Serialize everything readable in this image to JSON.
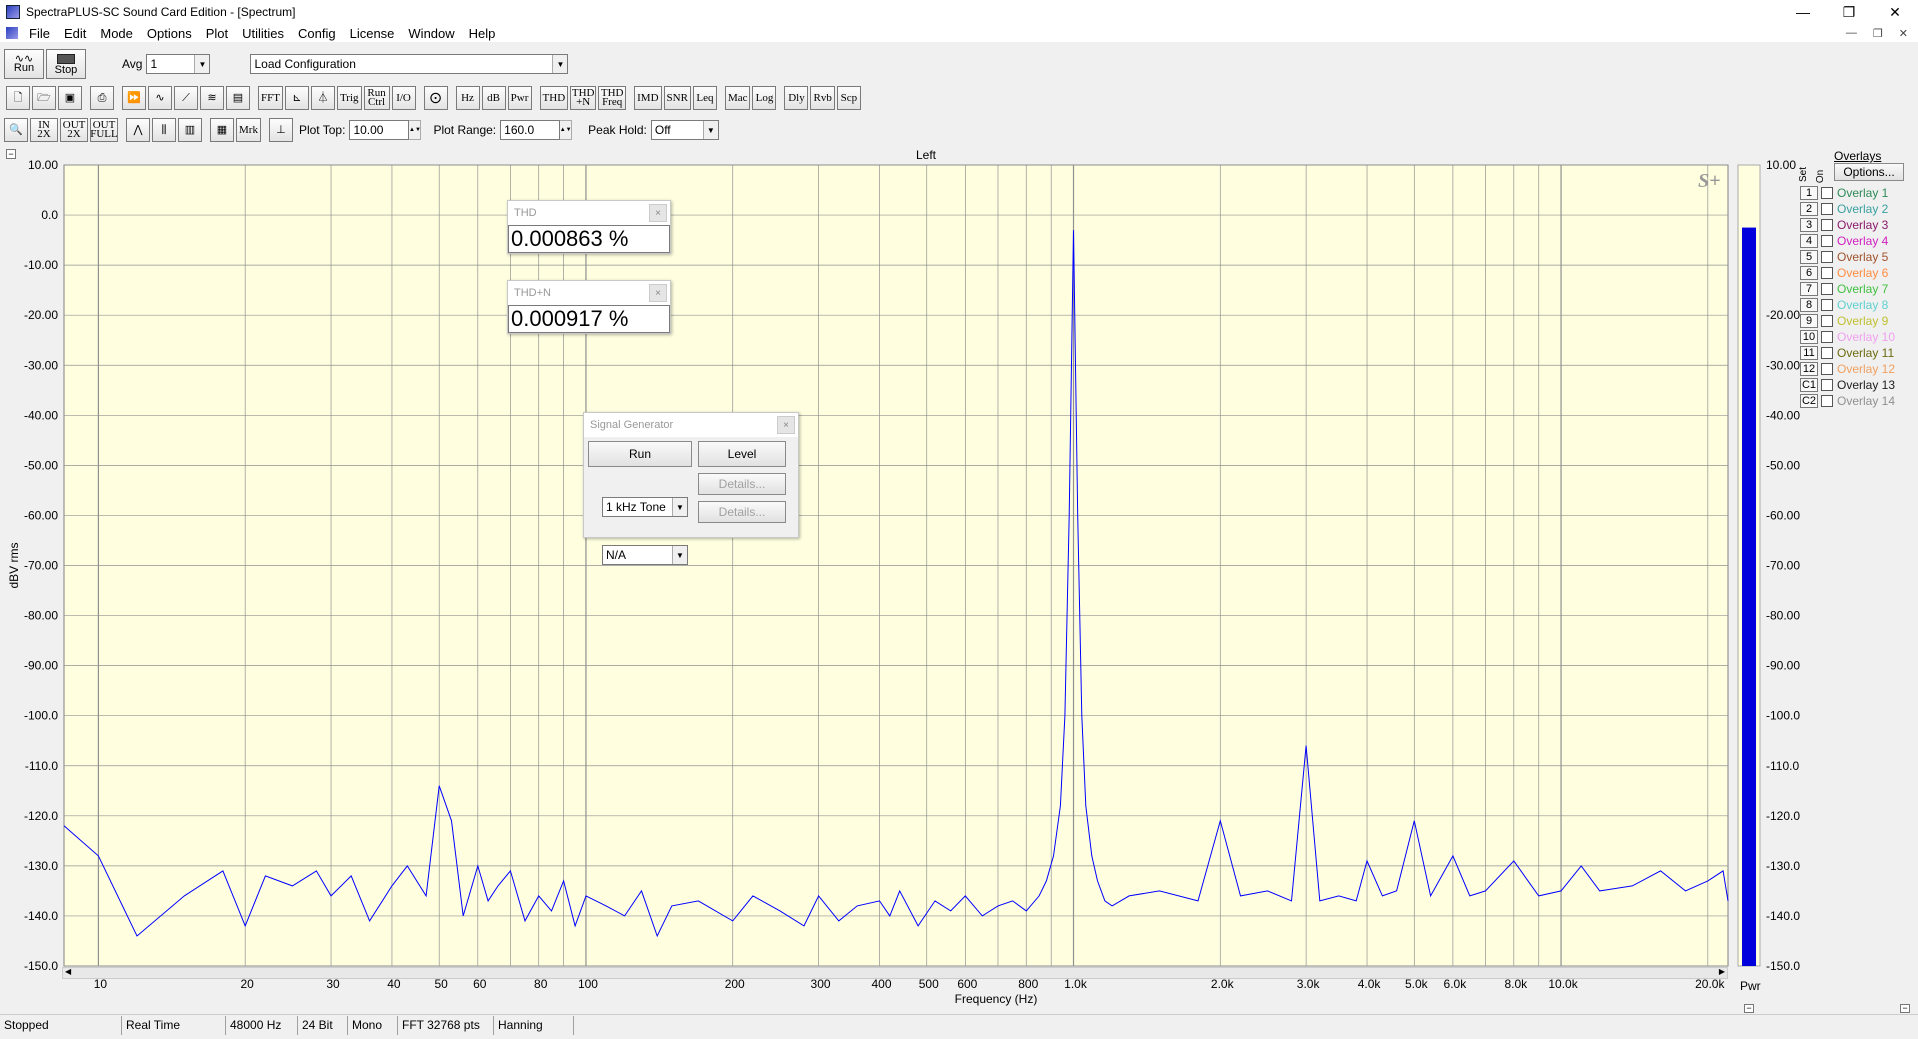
{
  "window": {
    "title": "SpectraPLUS-SC Sound Card Edition - [Spectrum]",
    "controls": [
      "—",
      "❐",
      "✕"
    ],
    "mdi_controls": [
      "—",
      "❐",
      "✕"
    ]
  },
  "menu": [
    "File",
    "Edit",
    "Mode",
    "Options",
    "Plot",
    "Utilities",
    "Config",
    "License",
    "Window",
    "Help"
  ],
  "toolbar1": {
    "run_label": "Run",
    "stop_label": "Stop",
    "avg_label": "Avg",
    "avg_value": "1",
    "config_value": "Load Configuration"
  },
  "toolbar2": [
    "FFT",
    "Trig",
    "Run Ctrl",
    "I/O",
    "Hz",
    "dB",
    "Pwr",
    "THD",
    "THD +N",
    "THD Freq",
    "IMD",
    "SNR",
    "Leq",
    "Mac",
    "Log",
    "Dly",
    "Rvb",
    "Scp"
  ],
  "toolbar3": {
    "icon_labels": [
      "IN 2X",
      "OUT 2X",
      "OUT FULL",
      "Mrk"
    ],
    "plot_top_label": "Plot Top:",
    "plot_top_value": "10.00",
    "plot_range_label": "Plot Range:",
    "plot_range_value": "160.0",
    "peak_hold_label": "Peak Hold:",
    "peak_hold_value": "Off"
  },
  "plot": {
    "channel_label": "Left",
    "watermark": "S+",
    "ylabel": "dBV rms",
    "xlabel": "Frequency (Hz)",
    "pwr_label": "Pwr",
    "y_ticks": [
      "10.00",
      "0.0",
      "-10.00",
      "-20.00",
      "-30.00",
      "-40.00",
      "-50.00",
      "-60.00",
      "-70.00",
      "-80.00",
      "-90.00",
      "-100.0",
      "-110.0",
      "-120.0",
      "-130.0",
      "-140.0",
      "-150.0"
    ],
    "x_ticks": [
      "10",
      "20",
      "30",
      "40",
      "50",
      "60",
      "80",
      "100",
      "200",
      "300",
      "400",
      "500",
      "600",
      "800",
      "1.0k",
      "2.0k",
      "3.0k",
      "4.0k",
      "5.0k",
      "6.0k",
      "8.0k",
      "10.0k",
      "20.0k"
    ],
    "meter_ticks": [
      "10.00",
      "-20.00",
      "-30.00",
      "-40.00",
      "-50.00",
      "-60.00",
      "-70.00",
      "-80.00",
      "-90.00",
      "-100.0",
      "-110.0",
      "-120.0",
      "-130.0",
      "-140.0",
      "-150.0"
    ],
    "meter_level_db": -2.5,
    "plot_bg": "#ffffe0",
    "trace_color": "#0000ff"
  },
  "chart_data": {
    "type": "line",
    "title": "Left",
    "xlabel": "Frequency (Hz)",
    "ylabel": "dBV rms",
    "xscale": "log",
    "xlim": [
      8.5,
      22000
    ],
    "ylim": [
      -150,
      10
    ],
    "grid": true,
    "series": [
      {
        "x": [
          8.5,
          10,
          12,
          15,
          18,
          20,
          22,
          25,
          28,
          30,
          33,
          36,
          40,
          43,
          47,
          50,
          53,
          56,
          60,
          63,
          66,
          70,
          75,
          80,
          85,
          90,
          95,
          100,
          110,
          120,
          130,
          140,
          150,
          170,
          200,
          220,
          250,
          280,
          300,
          330,
          360,
          400,
          420,
          440,
          480,
          520,
          560,
          600,
          650,
          700,
          750,
          800,
          850,
          880,
          910,
          940,
          960,
          980,
          1000,
          1020,
          1040,
          1060,
          1090,
          1120,
          1160,
          1200,
          1300,
          1500,
          1800,
          2000,
          2200,
          2500,
          2800,
          3000,
          3200,
          3500,
          3800,
          4000,
          4300,
          4600,
          5000,
          5400,
          6000,
          6500,
          7000,
          8000,
          9000,
          10000,
          11000,
          12000,
          14000,
          16000,
          18000,
          20000,
          21500,
          22000
        ],
        "y": [
          -122,
          -128,
          -144,
          -136,
          -131,
          -142,
          -132,
          -134,
          -131,
          -136,
          -132,
          -141,
          -134,
          -130,
          -136,
          -114,
          -121,
          -140,
          -130,
          -137,
          -134,
          -131,
          -141,
          -136,
          -139,
          -133,
          -142,
          -136,
          -138,
          -140,
          -135,
          -144,
          -138,
          -137,
          -141,
          -136,
          -139,
          -142,
          -136,
          -141,
          -138,
          -137,
          -140,
          -135,
          -142,
          -137,
          -139,
          -136,
          -140,
          -138,
          -137,
          -139,
          -136,
          -133,
          -128,
          -118,
          -100,
          -60,
          -3,
          -60,
          -100,
          -118,
          -128,
          -133,
          -137,
          -138,
          -136,
          -135,
          -137,
          -121,
          -136,
          -135,
          -137,
          -106,
          -137,
          -136,
          -137,
          -129,
          -136,
          -135,
          -121,
          -136,
          -128,
          -136,
          -135,
          -129,
          -136,
          -135,
          -130,
          -135,
          -134,
          -131,
          -135,
          -133,
          -131,
          -137
        ]
      }
    ]
  },
  "thd_box": {
    "title": "THD",
    "value": "0.000863 %"
  },
  "thdn_box": {
    "title": "THD+N",
    "value": "0.000917 %"
  },
  "siggen": {
    "title": "Signal Generator",
    "run_label": "Run",
    "level_label": "Level",
    "wave_value": "1 kHz Tone",
    "wave2_value": "N/A",
    "details_label": "Details..."
  },
  "overlays": {
    "title": "Overlays",
    "options_label": "Options...",
    "col_set": "Set",
    "col_on": "On",
    "items": [
      {
        "set": "1",
        "name": "Overlay 1",
        "color": "#2e8b57"
      },
      {
        "set": "2",
        "name": "Overlay 2",
        "color": "#3aa0a0"
      },
      {
        "set": "3",
        "name": "Overlay 3",
        "color": "#8b1a6b"
      },
      {
        "set": "4",
        "name": "Overlay 4",
        "color": "#d020c0"
      },
      {
        "set": "5",
        "name": "Overlay 5",
        "color": "#a0522d"
      },
      {
        "set": "6",
        "name": "Overlay 6",
        "color": "#ff8c40"
      },
      {
        "set": "7",
        "name": "Overlay 7",
        "color": "#40c040"
      },
      {
        "set": "8",
        "name": "Overlay 8",
        "color": "#60d0d0"
      },
      {
        "set": "9",
        "name": "Overlay 9",
        "color": "#c0c030"
      },
      {
        "set": "10",
        "name": "Overlay 10",
        "color": "#f0a0f0"
      },
      {
        "set": "11",
        "name": "Overlay 11",
        "color": "#6b6b10"
      },
      {
        "set": "12",
        "name": "Overlay 12",
        "color": "#f0a060"
      },
      {
        "set": "C1",
        "name": "Overlay 13",
        "color": "#202020"
      },
      {
        "set": "C2",
        "name": "Overlay 14",
        "color": "#909090"
      }
    ]
  },
  "status": [
    "Stopped",
    "Real Time",
    "48000 Hz",
    "24 Bit",
    "Mono",
    "FFT 32768 pts",
    "Hanning"
  ]
}
